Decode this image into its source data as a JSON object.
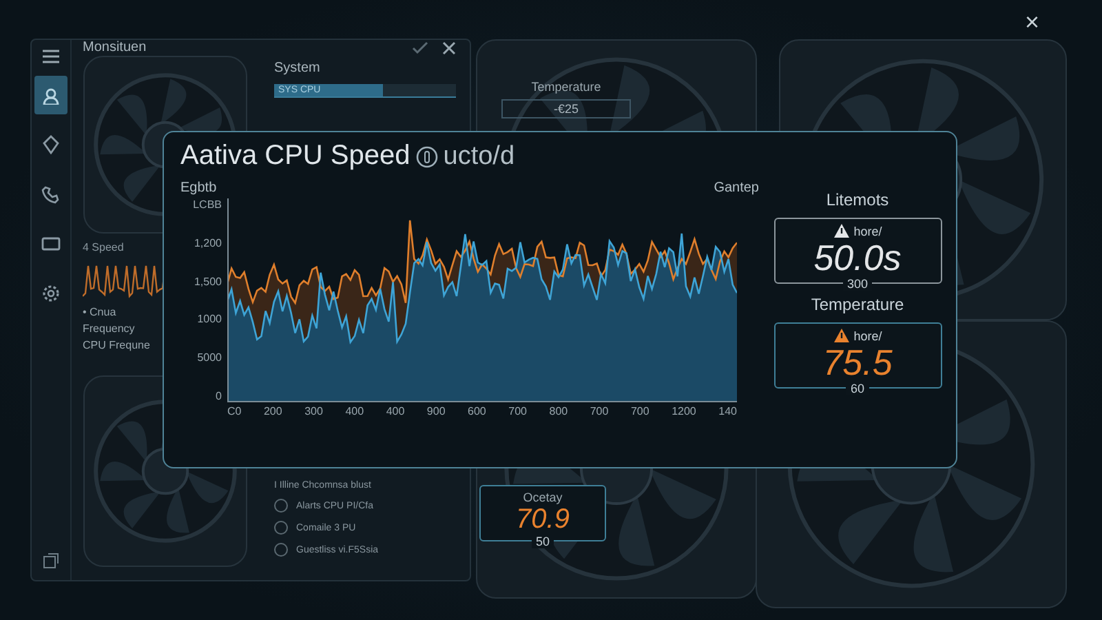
{
  "desktop": {
    "close_glyph": "×"
  },
  "back_window": {
    "title": "Monsituen",
    "sidebar": {
      "items": [
        {
          "kind": "users",
          "selected": true
        },
        {
          "kind": "pin",
          "selected": false
        },
        {
          "kind": "phone",
          "selected": false
        },
        {
          "kind": "monitor",
          "selected": false
        },
        {
          "kind": "gear",
          "selected": false
        }
      ]
    },
    "section_title": "System",
    "usage_bar": {
      "label": "SYS CPU",
      "level": 0.6
    },
    "speed_label": "4 Speed",
    "legend": [
      "• Cnua",
      "Frequency",
      "CPU Frequne"
    ],
    "checklist_heading": "I Illine Chcomnsa blust",
    "options": [
      {
        "label": "Alarts CPU PI/Cfa",
        "checked": false
      },
      {
        "label": "Comaile 3 PU",
        "checked": false
      },
      {
        "label": "Guestliss vi.F5Ssia",
        "checked": false
      }
    ]
  },
  "top_card": {
    "title": "Temperature",
    "value": "-€25"
  },
  "speed_panel": {
    "title": "Aativa CPU Speed",
    "unit": "ucto/d",
    "y_label": "Egbtb",
    "side_label": "Gantep",
    "y_ticks": [
      "LCBB",
      "1,200",
      "1,500",
      "1000",
      "5000",
      "0"
    ],
    "x_ticks": [
      "C0",
      "200",
      "300",
      "400",
      "400",
      "900",
      "600",
      "700",
      "800",
      "700",
      "700",
      "1200",
      "140"
    ],
    "gauges": [
      {
        "title": "Litemots",
        "badge": "hore/",
        "value": "50.0s",
        "scale": "300",
        "color": "#e4e6e8"
      },
      {
        "title": "Temperature",
        "badge": "hore/",
        "value": "75.5",
        "scale": "60",
        "color": "#e9822e"
      }
    ]
  },
  "bottom_gauge": {
    "title": "Ocetay",
    "value": "70.9",
    "scale": "50",
    "color": "#e9822e"
  }
}
